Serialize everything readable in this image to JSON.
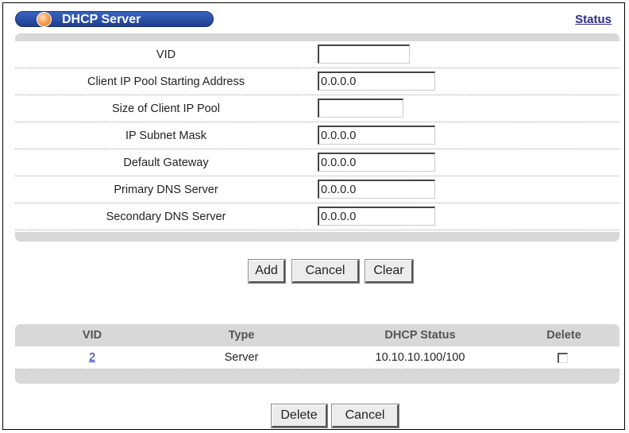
{
  "header": {
    "title": "DHCP Server",
    "status_link": "Status",
    "icon": "orb-icon"
  },
  "form": {
    "rows": [
      {
        "label": "VID",
        "value": ""
      },
      {
        "label": "Client IP Pool Starting Address",
        "value": "0.0.0.0"
      },
      {
        "label": "Size of Client IP Pool",
        "value": ""
      },
      {
        "label": "IP Subnet Mask",
        "value": "0.0.0.0"
      },
      {
        "label": "Default Gateway",
        "value": "0.0.0.0"
      },
      {
        "label": "Primary DNS Server",
        "value": "0.0.0.0"
      },
      {
        "label": "Secondary DNS Server",
        "value": "0.0.0.0"
      }
    ],
    "buttons": {
      "add": "Add",
      "cancel": "Cancel",
      "clear": "Clear"
    }
  },
  "table": {
    "headers": [
      "VID",
      "Type",
      "DHCP Status",
      "Delete"
    ],
    "rows": [
      {
        "vid": "2",
        "type": "Server",
        "dhcp_status": "10.10.10.100/100",
        "delete_checked": false
      }
    ],
    "buttons": {
      "delete": "Delete",
      "cancel": "Cancel"
    }
  },
  "colors": {
    "title_pill": "#1f3f8f",
    "panel_gray": "#d8d8d8",
    "link": "#1a2aa8"
  }
}
